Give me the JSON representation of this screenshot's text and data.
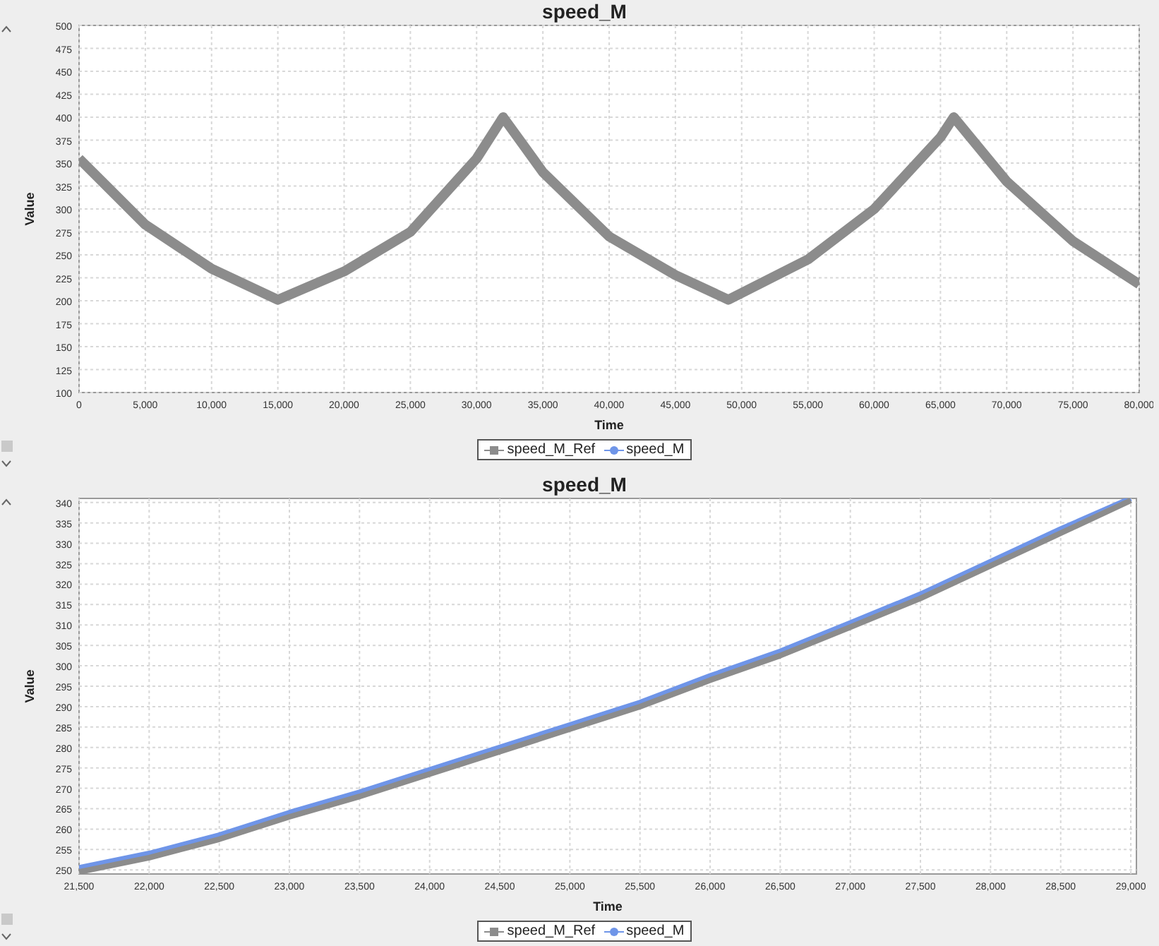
{
  "charts": [
    {
      "chart_data": {
        "type": "line",
        "title": "speed_M",
        "xlabel": "Time",
        "ylabel": "Value",
        "x": [
          0,
          5000,
          10000,
          15000,
          20000,
          25000,
          30000,
          32000,
          35000,
          40000,
          45000,
          49000,
          55000,
          60000,
          65000,
          66000,
          70000,
          75000,
          80000
        ],
        "series": [
          {
            "name": "speed_M_Ref",
            "color": "#8c8c8c",
            "values": [
              355,
              283,
              235,
              201,
              232,
              275,
              355,
              400,
              340,
              270,
              228,
              201,
              245,
              300,
              378,
              400,
              330,
              265,
              218
            ]
          },
          {
            "name": "speed_M",
            "color": "#6f95e8",
            "values": [
              null,
              null,
              null,
              null,
              null,
              null,
              null,
              null,
              null,
              null,
              null,
              null,
              null,
              null,
              null,
              null,
              null,
              null,
              null
            ]
          }
        ],
        "xlim": [
          0,
          80000
        ],
        "ylim": [
          100,
          500
        ],
        "grid": true,
        "legend": "bottom",
        "xticks": [
          0,
          {
            "value": 5000,
            "label": "5,000"
          },
          {
            "value": 10000,
            "label": "10,000"
          },
          {
            "value": 15000,
            "label": "15,000"
          },
          {
            "value": 20000,
            "label": "20,000"
          },
          {
            "value": 25000,
            "label": "25,000"
          },
          {
            "value": 30000,
            "label": "30,000"
          },
          {
            "value": 35000,
            "label": "35,000"
          },
          {
            "value": 40000,
            "label": "40,000"
          },
          {
            "value": 45000,
            "label": "45,000"
          },
          {
            "value": 50000,
            "label": "50,000"
          },
          {
            "value": 55000,
            "label": "55,000"
          },
          {
            "value": 60000,
            "label": "60,000"
          },
          {
            "value": 65000,
            "label": "65,000"
          },
          {
            "value": 70000,
            "label": "70,000"
          },
          {
            "value": 75000,
            "label": "75,000"
          },
          {
            "value": 80000,
            "label": "80,000"
          }
        ],
        "yticks": [
          100,
          125,
          150,
          175,
          200,
          225,
          250,
          275,
          300,
          325,
          350,
          375,
          400,
          425,
          450,
          475,
          500
        ]
      }
    },
    {
      "chart_data": {
        "type": "line",
        "title": "speed_M",
        "xlabel": "Time",
        "ylabel": "Value",
        "x": [
          21500,
          22000,
          22500,
          23000,
          23500,
          24000,
          24500,
          25000,
          25500,
          26000,
          26500,
          27000,
          27500,
          28000,
          28500,
          29000
        ],
        "series": [
          {
            "name": "speed_M_Ref",
            "color": "#8c8c8c",
            "values": [
              249.5,
              253,
              257.5,
              263,
              268,
              273.5,
              279,
              284.5,
              290,
              296.5,
              302.5,
              309.5,
              316.5,
              324.5,
              332.5,
              340.5
            ]
          },
          {
            "name": "speed_M",
            "color": "#6f95e8",
            "values": [
              250.5,
              254,
              258.5,
              264,
              269,
              274.5,
              280,
              285.5,
              291,
              297.5,
              303.5,
              310.5,
              317.5,
              325.5,
              333.5,
              341
            ]
          }
        ],
        "xlim": [
          21500,
          29040
        ],
        "ylim": [
          249,
          341
        ],
        "grid": true,
        "legend": "bottom",
        "xticks": [
          {
            "value": 21500,
            "label": "21,500"
          },
          {
            "value": 22000,
            "label": "22,000"
          },
          {
            "value": 22500,
            "label": "22,500"
          },
          {
            "value": 23000,
            "label": "23,000"
          },
          {
            "value": 23500,
            "label": "23,500"
          },
          {
            "value": 24000,
            "label": "24,000"
          },
          {
            "value": 24500,
            "label": "24,500"
          },
          {
            "value": 25000,
            "label": "25,000"
          },
          {
            "value": 25500,
            "label": "25,500"
          },
          {
            "value": 26000,
            "label": "26,000"
          },
          {
            "value": 26500,
            "label": "26,500"
          },
          {
            "value": 27000,
            "label": "27,000"
          },
          {
            "value": 27500,
            "label": "27,500"
          },
          {
            "value": 28000,
            "label": "28,000"
          },
          {
            "value": 28500,
            "label": "28,500"
          },
          {
            "value": 29000,
            "label": "29,000"
          }
        ],
        "yticks": [
          250,
          255,
          260,
          265,
          270,
          275,
          280,
          285,
          290,
          295,
          300,
          305,
          310,
          315,
          320,
          325,
          330,
          335,
          340
        ]
      }
    }
  ]
}
